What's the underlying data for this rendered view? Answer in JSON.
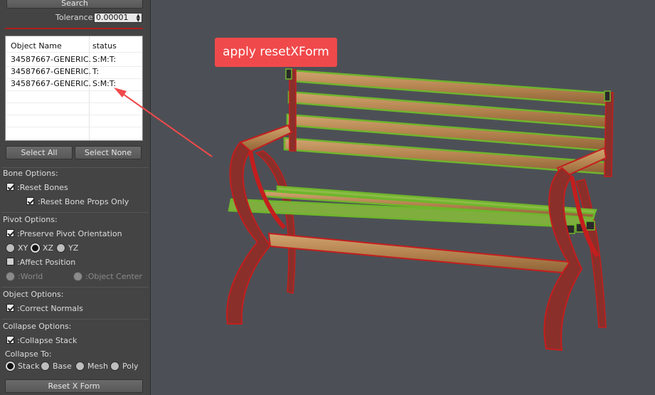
{
  "panel": {
    "search_button": "Search",
    "tolerance_label": "Tolerance:",
    "tolerance_value": "0.00001",
    "table": {
      "headers": [
        "Object Name",
        "status"
      ],
      "rows": [
        {
          "name": "34587667-GENERIC...",
          "status": "S:M:T:"
        },
        {
          "name": "34587667-GENERIC...",
          "status": "T:"
        },
        {
          "name": "34587667-GENERIC...",
          "status": "S:M:T:"
        }
      ]
    },
    "select_all": "Select All",
    "select_none": "Select None",
    "bone_options": {
      "title": "Bone Options:",
      "reset_bones": ":Reset Bones",
      "reset_bone_props": ":Reset Bone Props Only"
    },
    "pivot_options": {
      "title": "Pivot Options:",
      "preserve": ":Preserve Pivot Orientation",
      "axes": [
        "XY",
        "XZ",
        "YZ"
      ],
      "selected_axis": "XZ",
      "affect_position": ":Affect Position",
      "world": ":World",
      "object_center": ":Object Center"
    },
    "object_options": {
      "title": "Object Options:",
      "correct_normals": ":Correct Normals"
    },
    "collapse_options": {
      "title": "Collapse Options:",
      "collapse_stack": ":Collapse Stack",
      "collapse_to": "Collapse To:",
      "targets": [
        "Stack",
        "Base",
        "Mesh",
        "Poly"
      ],
      "selected_target": "Stack"
    },
    "reset_button": "Reset X Form"
  },
  "viewport": {
    "annotation": "apply resetXForm",
    "annotation_color": "#f0494b"
  },
  "colors": {
    "panel_bg": "#444444",
    "viewport_bg": "#4c5056",
    "wood": "#b98b5a",
    "selection_green": "#6fb52c",
    "wireframe_red": "#c41e1e"
  }
}
